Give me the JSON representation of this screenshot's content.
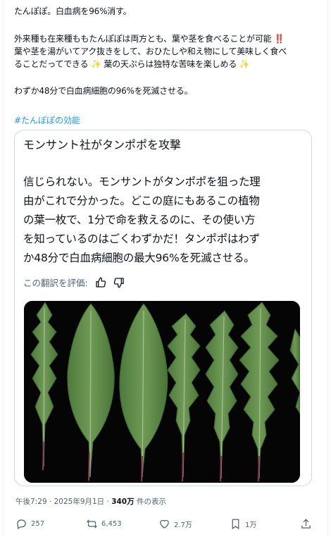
{
  "post": {
    "line1": "たんぽぽ。白血病を96%消す。",
    "line2": "外来種も在来種ももたんぽぽは両方とも、葉や茎を食べることが可能 ‼️",
    "line3": "葉や茎を湯がいてアク抜きをして、おひたしや和え物にして美味しく食べ",
    "line4": "ることだってできる ✨ 葉の天ぷらは独特な苦味を楽しめる ✨",
    "line5": "わずか48分で白血病細胞の96%を死滅させる。",
    "hashtag": "#たんぽぽの効能"
  },
  "card": {
    "head": "モンサント社がタンポポを攻撃",
    "body": [
      "信じられない。モンサントがタンポポを狙った理",
      "由がこれで分かった。どこの庭にもあるこの植物",
      "の葉一枚で、1分で命を救えるのに、その使い方",
      "を知っているのはごくわずかだ！タンポポはわず",
      "か48分で白血病細胞の最大96%を死滅させる。"
    ],
    "rate_label": "この翻訳を評価:"
  },
  "meta": {
    "time": "午後7:29 · 2025年9月1日 · ",
    "views_count": "340万",
    "views_label": " 件の表示"
  },
  "actions": {
    "reply": "257",
    "retweet": "6,453",
    "like": "2.7万",
    "bookmark": "1万"
  },
  "icons": [
    "thumbs-up-icon",
    "thumbs-down-icon",
    "reply-icon",
    "retweet-icon",
    "like-icon",
    "bookmark-icon",
    "share-icon"
  ]
}
